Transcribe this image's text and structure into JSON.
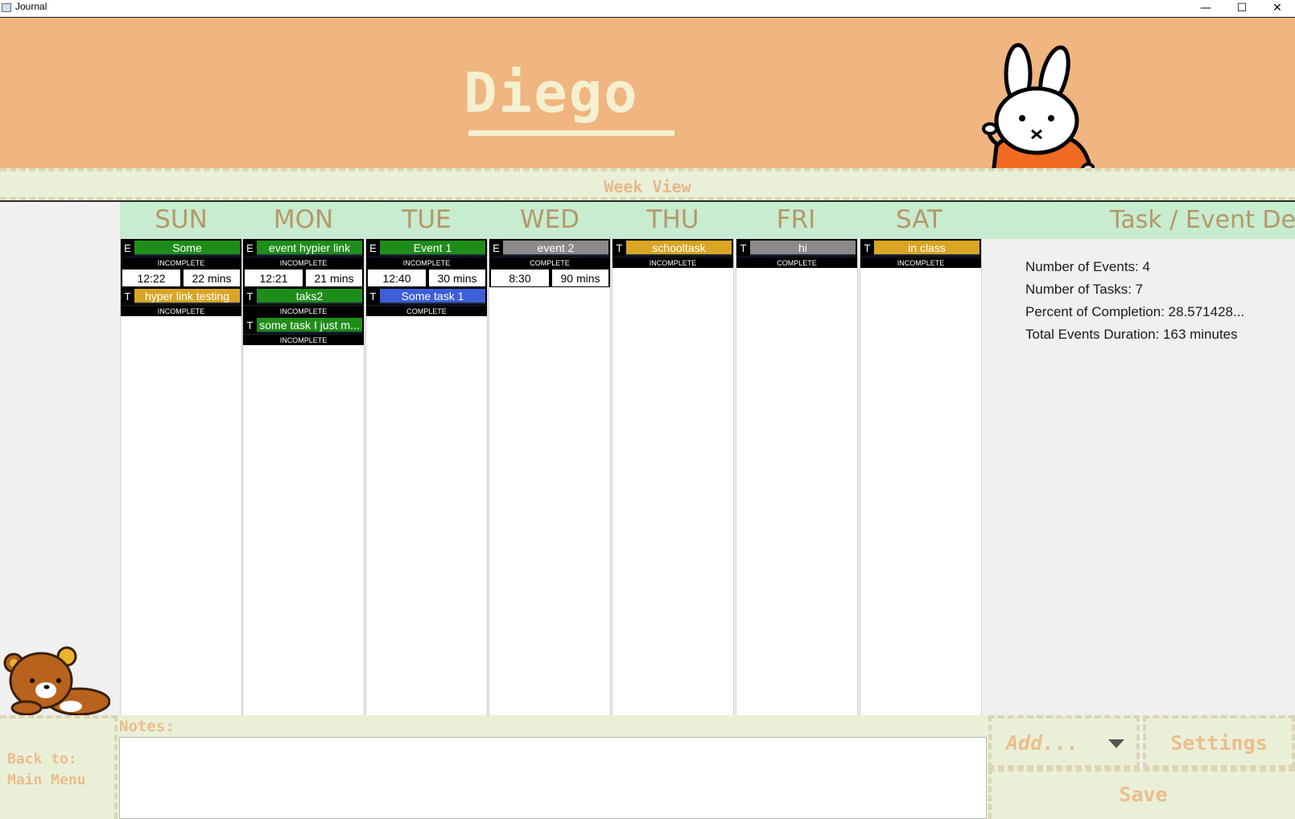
{
  "window": {
    "title": "Journal",
    "minimize": "—",
    "maximize": "☐",
    "close": "✕"
  },
  "header": {
    "name": "Diego"
  },
  "week_view": {
    "label": "Week View"
  },
  "days": [
    {
      "name": "SUN",
      "items": [
        {
          "kind": "E",
          "name": "Some",
          "color": "#1f8d19",
          "status": "INCOMPLETE",
          "start": "12:22",
          "duration": "22 mins"
        },
        {
          "kind": "T",
          "name": "hyper link testing",
          "color": "#d8a525",
          "status": "INCOMPLETE"
        }
      ]
    },
    {
      "name": "MON",
      "items": [
        {
          "kind": "E",
          "name": "event hypier link",
          "color": "#1f8d19",
          "status": "INCOMPLETE",
          "start": "12:21",
          "duration": "21 mins"
        },
        {
          "kind": "T",
          "name": "taks2",
          "color": "#1f8d19",
          "status": "INCOMPLETE"
        },
        {
          "kind": "T",
          "name": "some task I just m...",
          "color": "#1f8d19",
          "status": "INCOMPLETE"
        }
      ]
    },
    {
      "name": "TUE",
      "items": [
        {
          "kind": "E",
          "name": "Event 1",
          "color": "#1f8d19",
          "status": "INCOMPLETE",
          "start": "12:40",
          "duration": "30 mins"
        },
        {
          "kind": "T",
          "name": "Some task 1",
          "color": "#3d5ed8",
          "status": "COMPLETE"
        }
      ]
    },
    {
      "name": "WED",
      "items": [
        {
          "kind": "E",
          "name": "event 2",
          "color": "#8a8a8a",
          "status": "COMPLETE",
          "start": "8:30",
          "duration": "90 mins"
        }
      ]
    },
    {
      "name": "THU",
      "items": [
        {
          "kind": "T",
          "name": "schooltask",
          "color": "#d8a525",
          "status": "INCOMPLETE"
        }
      ]
    },
    {
      "name": "FRI",
      "items": [
        {
          "kind": "T",
          "name": "hi",
          "color": "#8a8a8a",
          "status": "COMPLETE"
        }
      ]
    },
    {
      "name": "SAT",
      "items": [
        {
          "kind": "T",
          "name": "in class",
          "color": "#d8a525",
          "status": "INCOMPLETE"
        }
      ]
    }
  ],
  "details": {
    "title": "Task / Event Details",
    "events": "Number of Events: 4",
    "tasks": "Number of Tasks: 7",
    "completion": "Percent of Completion: 28.571428...",
    "duration": "Total Events Duration: 163 minutes"
  },
  "bottom": {
    "back_line1": "Back to:",
    "back_line2": "Main Menu",
    "notes_label": "Notes:",
    "notes_value": "",
    "add_label": "Add...",
    "settings_label": "Settings",
    "save_label": "Save"
  },
  "icons": {
    "bunny": "miffy-bunny-sticker",
    "bear": "rilakkuma-bear-sticker",
    "dropdown": "chevron-down-icon"
  }
}
